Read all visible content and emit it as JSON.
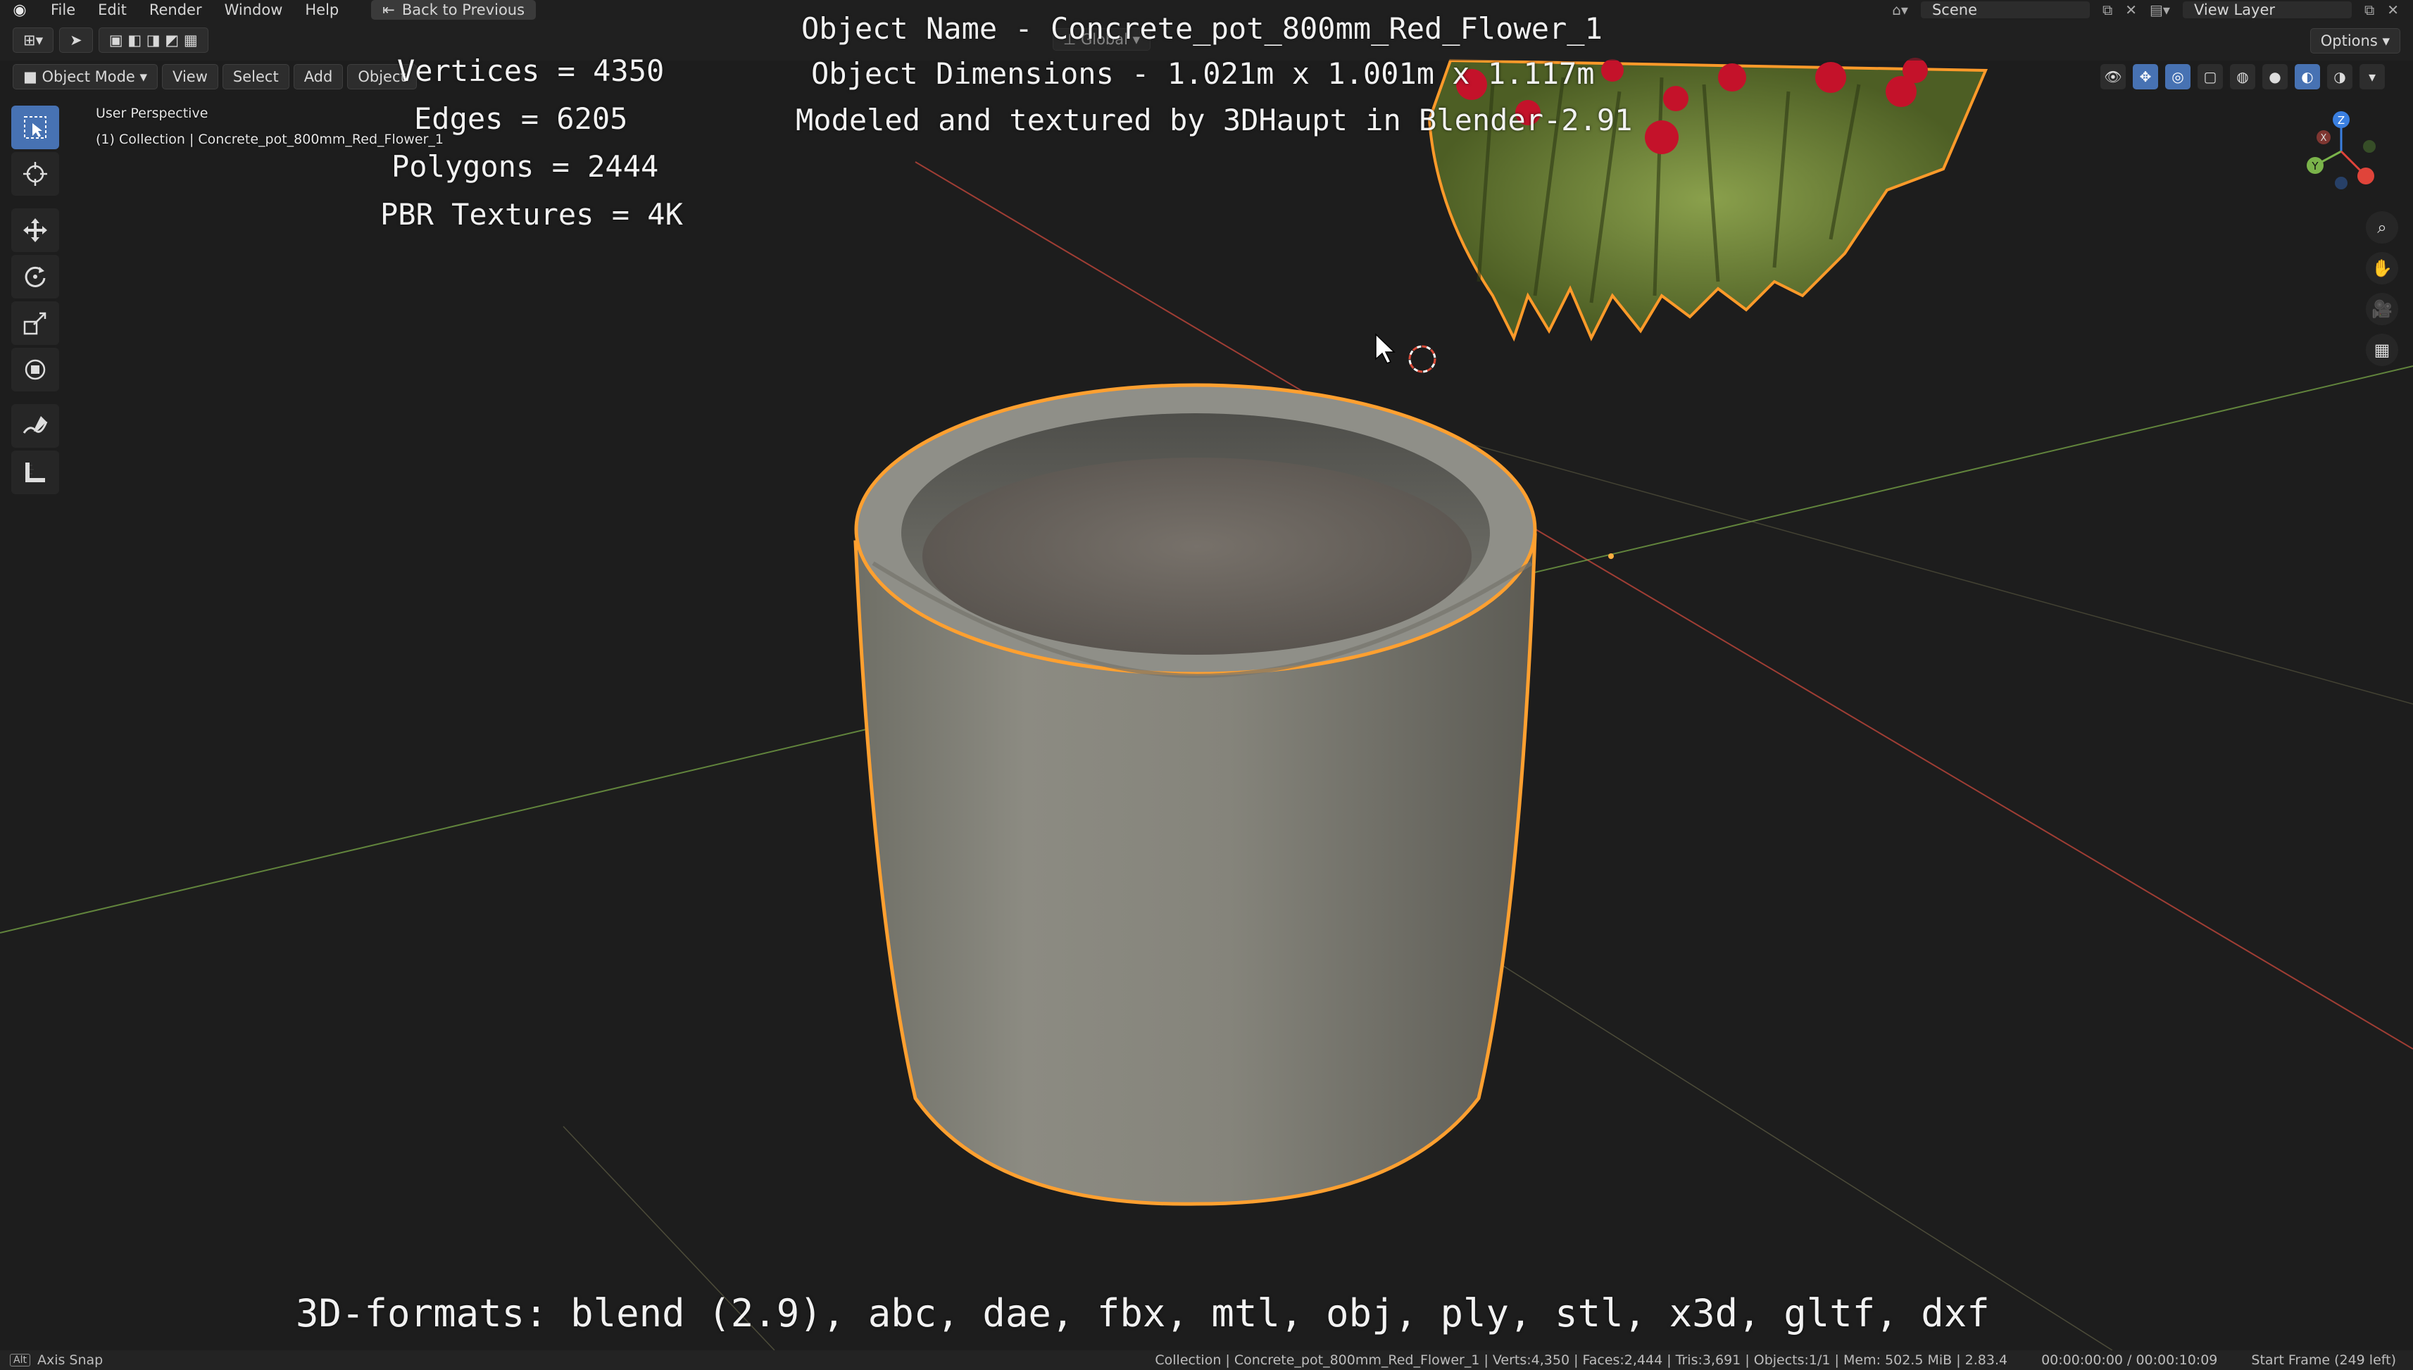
{
  "topbar": {
    "menu": [
      "File",
      "Edit",
      "Render",
      "Window",
      "Help"
    ],
    "back_label": "Back to Previous",
    "scene": "Scene",
    "view_layer": "View Layer"
  },
  "header": {
    "mode": "Object Mode",
    "menus": [
      "View",
      "Select",
      "Add",
      "Object"
    ],
    "orientation": "Global",
    "options_label": "Options"
  },
  "viewport": {
    "perspective": "User Perspective",
    "collection_path": "(1) Collection | Concrete_pot_800mm_Red_Flower_1"
  },
  "overlay": {
    "vertices": "Vertices = 4350",
    "edges": "Edges = 6205",
    "polygons": "Polygons = 2444",
    "textures": "PBR Textures = 4K",
    "object_name": "Object Name - Concrete_pot_800mm_Red_Flower_1",
    "dimensions": "Object Dimensions -  1.021m x 1.001m x 1.117m",
    "credit": "Modeled and textured by 3DHaupt in Blender-2.91",
    "formats": "3D-formats: blend (2.9), abc, dae, fbx, mtl, obj, ply, stl, x3d, gltf, dxf"
  },
  "gizmo": {
    "x": "X",
    "y": "Y",
    "z": "Z"
  },
  "statusbar": {
    "left": "Axis Snap",
    "stats": "Collection | Concrete_pot_800mm_Red_Flower_1 | Verts:4,350 | Faces:2,444 | Tris:3,691 | Objects:1/1 | Mem: 502.5 MiB | 2.83.4",
    "time": "00:00:00:00 / 00:00:10:09",
    "frame": "Start Frame (249 left)"
  }
}
